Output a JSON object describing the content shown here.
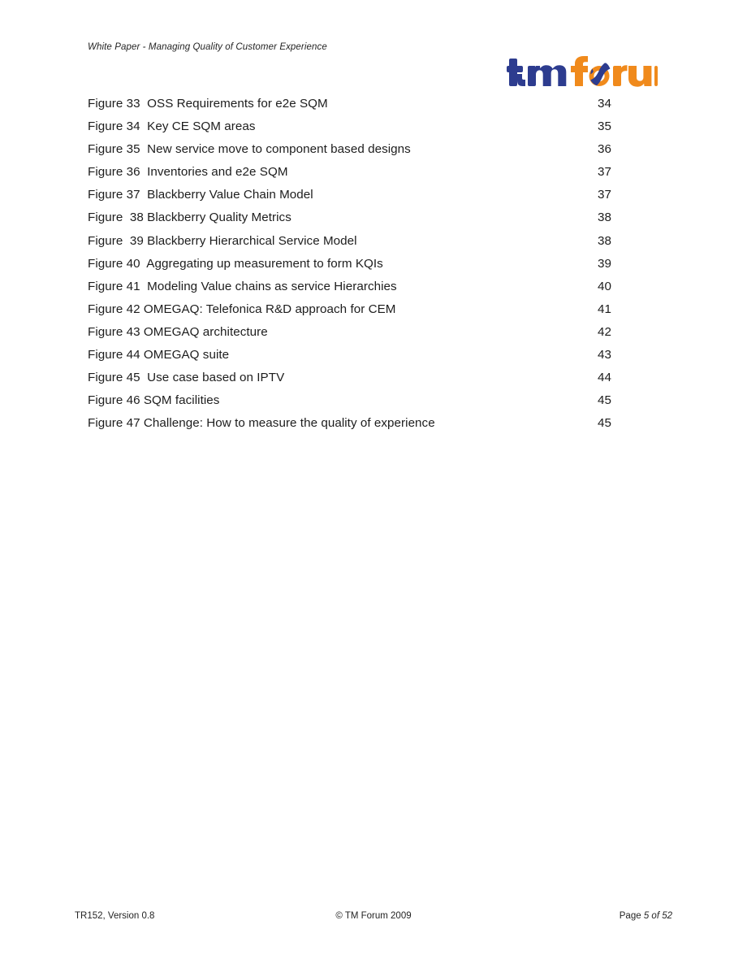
{
  "header": {
    "running_title": "White Paper - Managing Quality of Customer Experience"
  },
  "logo": {
    "name": "tmforum-logo",
    "text_primary": "tm",
    "text_secondary": "forum",
    "color_blue": "#2d3c8f",
    "color_orange": "#f08a1c"
  },
  "figure_list": {
    "entries": [
      {
        "caption": "Figure 33  OSS Requirements for e2e SQM",
        "page": "34"
      },
      {
        "caption": "Figure 34  Key CE SQM areas",
        "page": "35"
      },
      {
        "caption": "Figure 35  New service move to component based designs",
        "page": "36"
      },
      {
        "caption": "Figure 36  Inventories and e2e SQM",
        "page": "37"
      },
      {
        "caption": "Figure 37  Blackberry Value Chain Model",
        "page": "37"
      },
      {
        "caption": "Figure  38 Blackberry Quality Metrics",
        "page": "38"
      },
      {
        "caption": "Figure  39 Blackberry Hierarchical Service Model",
        "page": "38"
      },
      {
        "caption": "Figure 40  Aggregating up measurement to form KQIs",
        "page": "39"
      },
      {
        "caption": "Figure 41  Modeling Value chains as service Hierarchies",
        "page": "40"
      },
      {
        "caption": "Figure 42 OMEGAQ: Telefonica R&D approach for CEM",
        "page": "41"
      },
      {
        "caption": "Figure 43 OMEGAQ architecture",
        "page": "42"
      },
      {
        "caption": "Figure 44 OMEGAQ suite",
        "page": "43"
      },
      {
        "caption": "Figure 45  Use case based on IPTV",
        "page": "44"
      },
      {
        "caption": "Figure 46 SQM facilities",
        "page": "45"
      },
      {
        "caption": "Figure 47 Challenge: How to measure the quality of experience",
        "page": "45"
      }
    ]
  },
  "footer": {
    "left": "TR152, Version 0.8",
    "center": "© TM Forum 2009",
    "right_word": "Page ",
    "right_numbers": "5 of 52"
  }
}
